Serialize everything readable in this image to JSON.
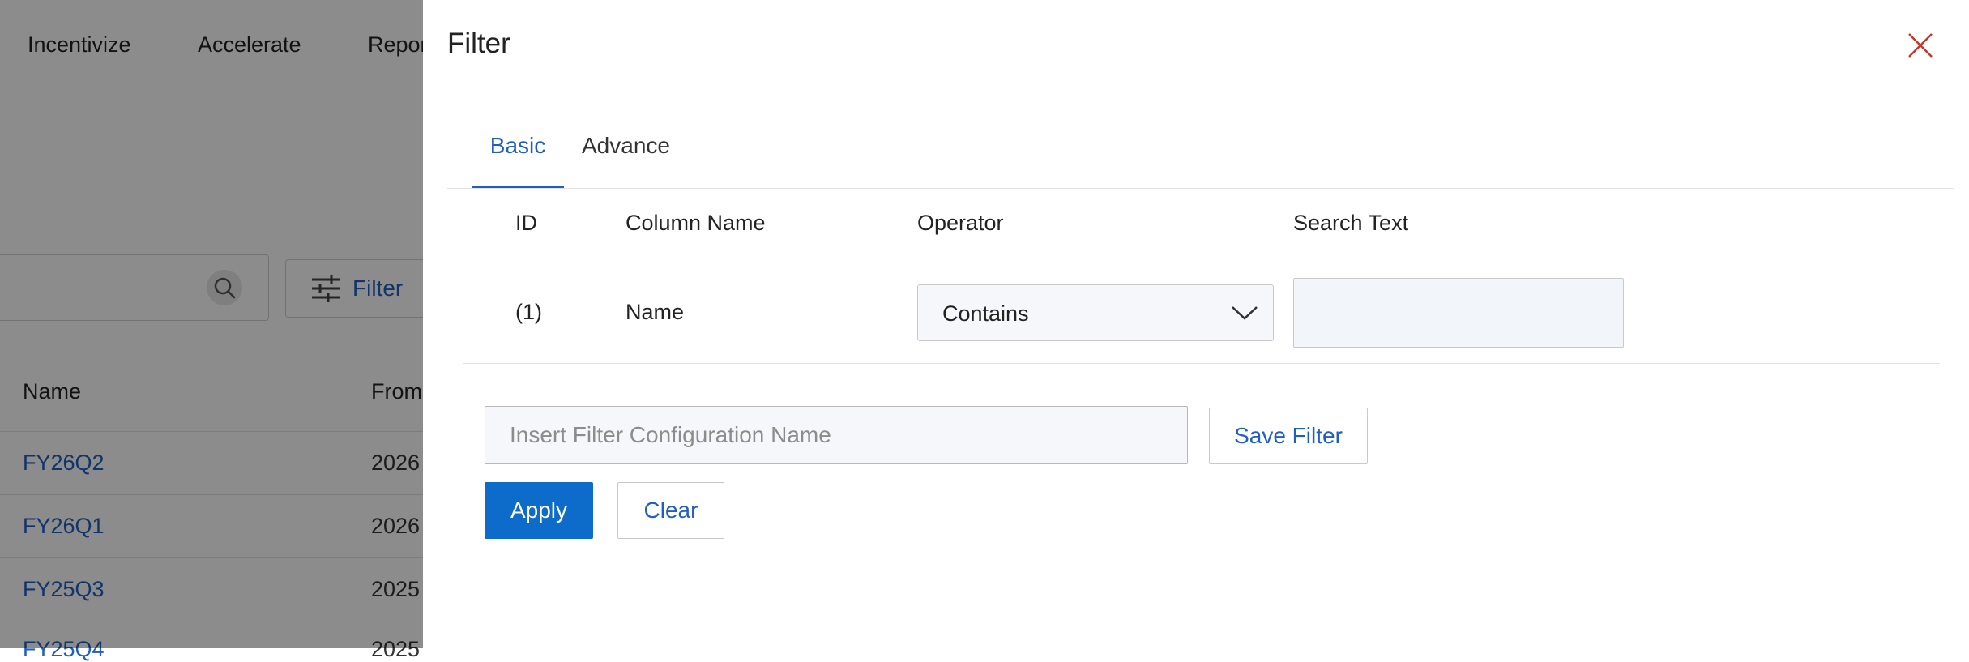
{
  "background": {
    "nav": [
      "Incentivize",
      "Accelerate",
      "Reports"
    ],
    "filter_button_label": "Filter",
    "columns": [
      "Name",
      "From"
    ],
    "rows": [
      {
        "name": "FY26Q2",
        "from": "2026"
      },
      {
        "name": "FY26Q1",
        "from": "2026"
      },
      {
        "name": "FY25Q3",
        "from": "2025"
      },
      {
        "name": "FY25Q4",
        "from": "2025"
      }
    ]
  },
  "drawer": {
    "title": "Filter",
    "tabs": [
      {
        "label": "Basic",
        "active": true
      },
      {
        "label": "Advance",
        "active": false
      }
    ],
    "grid": {
      "headers": {
        "id": "ID",
        "column": "Column Name",
        "operator": "Operator",
        "search": "Search Text"
      },
      "rows": [
        {
          "id": "(1)",
          "column": "Name",
          "operator": "Contains",
          "search_value": ""
        }
      ]
    },
    "config_placeholder": "Insert Filter Configuration Name",
    "save_label": "Save Filter",
    "apply_label": "Apply",
    "clear_label": "Clear"
  },
  "colors": {
    "accent": "#1f5fbf",
    "primary_button": "#0d6bc9",
    "close_icon": "#c0392b",
    "overlay": "rgba(0,0,0,0.45)"
  },
  "icons": {
    "close": "close-icon",
    "dropdown": "chevron-down-icon",
    "search": "search-icon",
    "filter": "sliders-icon"
  }
}
